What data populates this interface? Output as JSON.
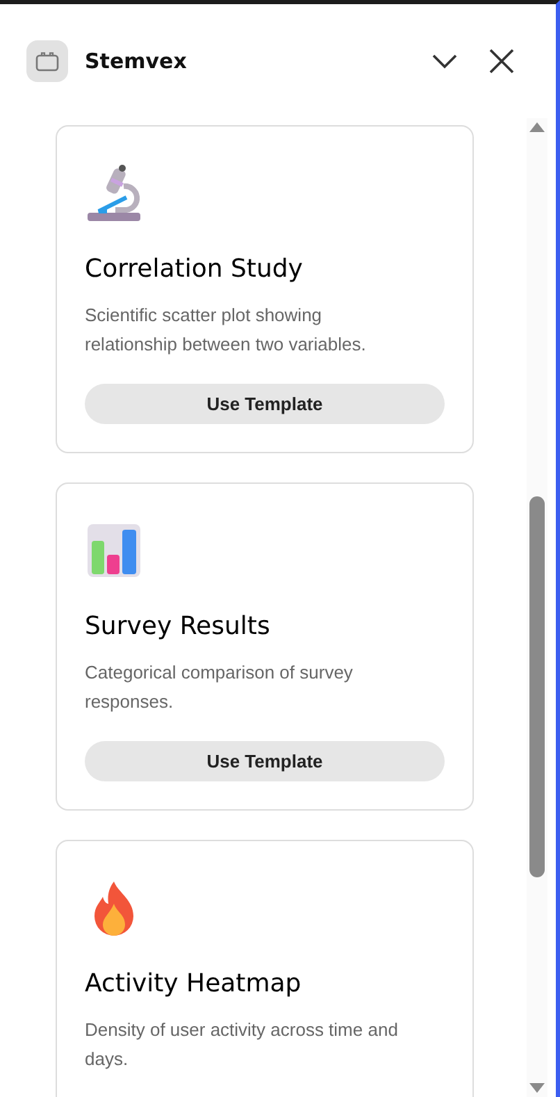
{
  "header": {
    "title": "Stemvex"
  },
  "templates": [
    {
      "title": "Correlation Study",
      "description": "Scientific scatter plot showing relationship between two variables.",
      "button": "Use Template"
    },
    {
      "title": "Survey Results",
      "description": "Categorical comparison of survey responses.",
      "button": "Use Template"
    },
    {
      "title": "Activity Heatmap",
      "description": "Density of user activity across time and days."
    }
  ]
}
